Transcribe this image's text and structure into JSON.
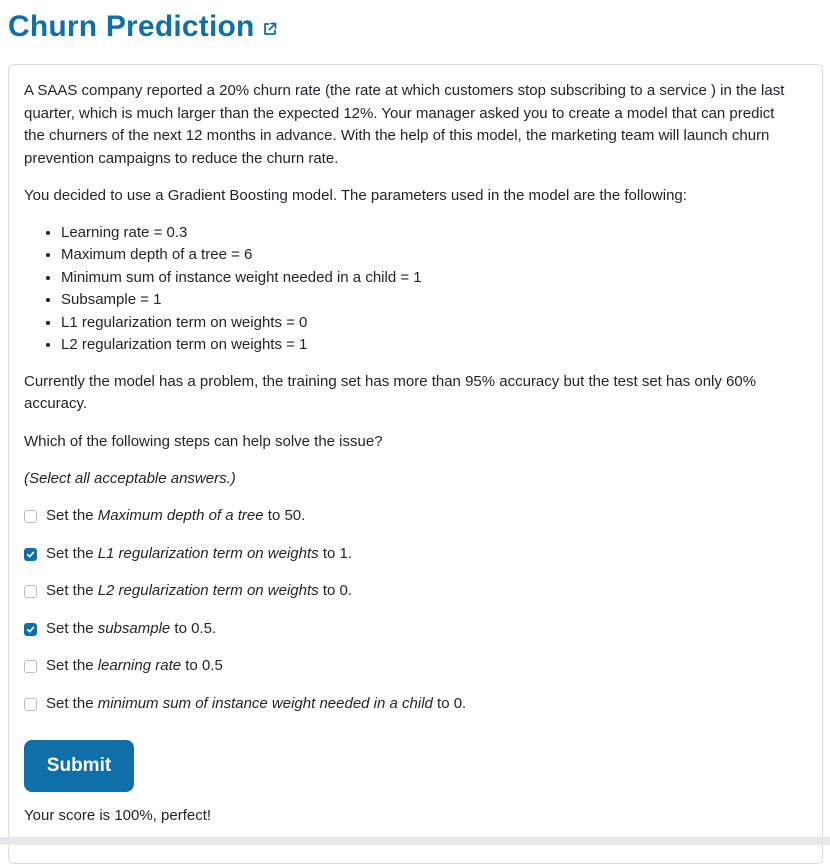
{
  "header": {
    "title": "Churn Prediction",
    "link_icon": "external-link-icon"
  },
  "question": {
    "intro": "A SAAS company reported a 20% churn rate (the rate at which customers stop subscribing to a service ) in the last quarter, which is much larger than the expected 12%. Your manager asked you to create a model that can predict the churners of the next 12 months in advance. With the help of this model, the marketing team will launch churn prevention campaigns to reduce the churn rate.",
    "model_text": "You decided to use a Gradient Boosting model. The parameters used in the model are the following:",
    "params": [
      "Learning rate = 0.3",
      "Maximum depth of a tree = 6",
      "Minimum sum of instance weight needed in a child = 1",
      "Subsample = 1",
      "L1 regularization term on weights = 0",
      "L2 regularization term on weights = 1"
    ],
    "problem": "Currently the model has a problem, the training set has more than 95% accuracy but the test set has only 60% accuracy.",
    "prompt": "Which of the following steps can help solve the issue?",
    "instruction": "(Select all acceptable answers.)"
  },
  "options": [
    {
      "pre": "Set the ",
      "em": "Maximum depth of a tree",
      "post": " to 50.",
      "checked": false
    },
    {
      "pre": "Set the ",
      "em": "L1 regularization term on weights",
      "post": " to 1.",
      "checked": true
    },
    {
      "pre": "Set the ",
      "em": "L2 regularization term on weights",
      "post": " to 0.",
      "checked": false
    },
    {
      "pre": "Set the ",
      "em": "subsample",
      "post": " to 0.5.",
      "checked": true
    },
    {
      "pre": "Set the ",
      "em": "learning rate",
      "post": " to 0.5",
      "checked": false
    },
    {
      "pre": "Set the ",
      "em": "minimum sum of instance weight needed in a child",
      "post": " to 0.",
      "checked": false
    }
  ],
  "submit_label": "Submit",
  "score_text": "Your score is 100%, perfect!",
  "colors": {
    "accent": "#0f6fa8",
    "border": "#d7dbe0"
  }
}
